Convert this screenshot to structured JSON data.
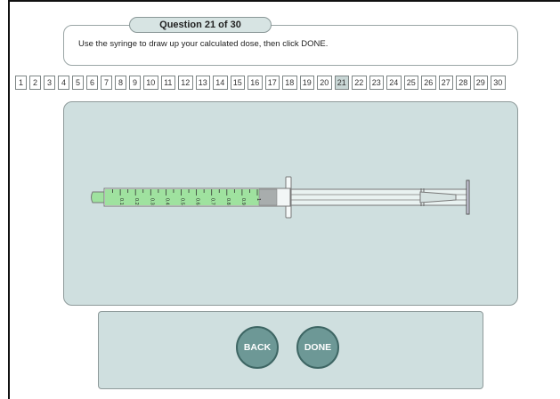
{
  "question": {
    "header": "Question 21 of 30",
    "instruction": "Use the syringe to draw up your calculated dose, then click DONE."
  },
  "pager": {
    "pages": [
      "1",
      "2",
      "3",
      "4",
      "5",
      "6",
      "7",
      "8",
      "9",
      "10",
      "11",
      "12",
      "13",
      "14",
      "15",
      "16",
      "17",
      "18",
      "19",
      "20",
      "21",
      "22",
      "23",
      "24",
      "25",
      "26",
      "27",
      "28",
      "29",
      "30"
    ],
    "current": "21"
  },
  "syringe": {
    "scale_labels": [
      "0.1",
      "0.2",
      "0.3",
      "0.4",
      "0.5",
      "0.6",
      "0.7",
      "0.8",
      "0.9",
      "1"
    ],
    "fill_color": "#9fe29f",
    "barrel_color": "#e9f2f1"
  },
  "buttons": {
    "back_label": "BACK",
    "done_label": "DONE"
  },
  "colors": {
    "panel": "#cfdfdf",
    "button": "#6d9896",
    "tab": "#d7e4e3"
  }
}
